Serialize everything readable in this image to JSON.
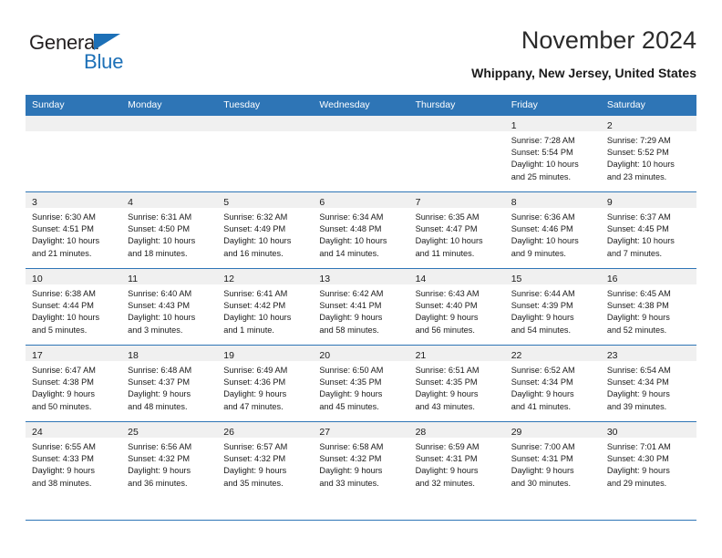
{
  "brand": {
    "name_part1": "General",
    "name_part2": "Blue",
    "triangle_color": "#1d70b7"
  },
  "header": {
    "title": "November 2024",
    "location": "Whippany, New Jersey, United States"
  },
  "theme": {
    "header_blue": "#2e75b6",
    "daynum_band": "#f0f0f0",
    "text": "#1a1a1a"
  },
  "weekday_headers": [
    "Sunday",
    "Monday",
    "Tuesday",
    "Wednesday",
    "Thursday",
    "Friday",
    "Saturday"
  ],
  "weeks": [
    [
      {
        "day": "",
        "sunrise": "",
        "sunset": "",
        "daylight_line1": "",
        "daylight_line2": ""
      },
      {
        "day": "",
        "sunrise": "",
        "sunset": "",
        "daylight_line1": "",
        "daylight_line2": ""
      },
      {
        "day": "",
        "sunrise": "",
        "sunset": "",
        "daylight_line1": "",
        "daylight_line2": ""
      },
      {
        "day": "",
        "sunrise": "",
        "sunset": "",
        "daylight_line1": "",
        "daylight_line2": ""
      },
      {
        "day": "",
        "sunrise": "",
        "sunset": "",
        "daylight_line1": "",
        "daylight_line2": ""
      },
      {
        "day": "1",
        "sunrise": "Sunrise: 7:28 AM",
        "sunset": "Sunset: 5:54 PM",
        "daylight_line1": "Daylight: 10 hours",
        "daylight_line2": "and 25 minutes."
      },
      {
        "day": "2",
        "sunrise": "Sunrise: 7:29 AM",
        "sunset": "Sunset: 5:52 PM",
        "daylight_line1": "Daylight: 10 hours",
        "daylight_line2": "and 23 minutes."
      }
    ],
    [
      {
        "day": "3",
        "sunrise": "Sunrise: 6:30 AM",
        "sunset": "Sunset: 4:51 PM",
        "daylight_line1": "Daylight: 10 hours",
        "daylight_line2": "and 21 minutes."
      },
      {
        "day": "4",
        "sunrise": "Sunrise: 6:31 AM",
        "sunset": "Sunset: 4:50 PM",
        "daylight_line1": "Daylight: 10 hours",
        "daylight_line2": "and 18 minutes."
      },
      {
        "day": "5",
        "sunrise": "Sunrise: 6:32 AM",
        "sunset": "Sunset: 4:49 PM",
        "daylight_line1": "Daylight: 10 hours",
        "daylight_line2": "and 16 minutes."
      },
      {
        "day": "6",
        "sunrise": "Sunrise: 6:34 AM",
        "sunset": "Sunset: 4:48 PM",
        "daylight_line1": "Daylight: 10 hours",
        "daylight_line2": "and 14 minutes."
      },
      {
        "day": "7",
        "sunrise": "Sunrise: 6:35 AM",
        "sunset": "Sunset: 4:47 PM",
        "daylight_line1": "Daylight: 10 hours",
        "daylight_line2": "and 11 minutes."
      },
      {
        "day": "8",
        "sunrise": "Sunrise: 6:36 AM",
        "sunset": "Sunset: 4:46 PM",
        "daylight_line1": "Daylight: 10 hours",
        "daylight_line2": "and 9 minutes."
      },
      {
        "day": "9",
        "sunrise": "Sunrise: 6:37 AM",
        "sunset": "Sunset: 4:45 PM",
        "daylight_line1": "Daylight: 10 hours",
        "daylight_line2": "and 7 minutes."
      }
    ],
    [
      {
        "day": "10",
        "sunrise": "Sunrise: 6:38 AM",
        "sunset": "Sunset: 4:44 PM",
        "daylight_line1": "Daylight: 10 hours",
        "daylight_line2": "and 5 minutes."
      },
      {
        "day": "11",
        "sunrise": "Sunrise: 6:40 AM",
        "sunset": "Sunset: 4:43 PM",
        "daylight_line1": "Daylight: 10 hours",
        "daylight_line2": "and 3 minutes."
      },
      {
        "day": "12",
        "sunrise": "Sunrise: 6:41 AM",
        "sunset": "Sunset: 4:42 PM",
        "daylight_line1": "Daylight: 10 hours",
        "daylight_line2": "and 1 minute."
      },
      {
        "day": "13",
        "sunrise": "Sunrise: 6:42 AM",
        "sunset": "Sunset: 4:41 PM",
        "daylight_line1": "Daylight: 9 hours",
        "daylight_line2": "and 58 minutes."
      },
      {
        "day": "14",
        "sunrise": "Sunrise: 6:43 AM",
        "sunset": "Sunset: 4:40 PM",
        "daylight_line1": "Daylight: 9 hours",
        "daylight_line2": "and 56 minutes."
      },
      {
        "day": "15",
        "sunrise": "Sunrise: 6:44 AM",
        "sunset": "Sunset: 4:39 PM",
        "daylight_line1": "Daylight: 9 hours",
        "daylight_line2": "and 54 minutes."
      },
      {
        "day": "16",
        "sunrise": "Sunrise: 6:45 AM",
        "sunset": "Sunset: 4:38 PM",
        "daylight_line1": "Daylight: 9 hours",
        "daylight_line2": "and 52 minutes."
      }
    ],
    [
      {
        "day": "17",
        "sunrise": "Sunrise: 6:47 AM",
        "sunset": "Sunset: 4:38 PM",
        "daylight_line1": "Daylight: 9 hours",
        "daylight_line2": "and 50 minutes."
      },
      {
        "day": "18",
        "sunrise": "Sunrise: 6:48 AM",
        "sunset": "Sunset: 4:37 PM",
        "daylight_line1": "Daylight: 9 hours",
        "daylight_line2": "and 48 minutes."
      },
      {
        "day": "19",
        "sunrise": "Sunrise: 6:49 AM",
        "sunset": "Sunset: 4:36 PM",
        "daylight_line1": "Daylight: 9 hours",
        "daylight_line2": "and 47 minutes."
      },
      {
        "day": "20",
        "sunrise": "Sunrise: 6:50 AM",
        "sunset": "Sunset: 4:35 PM",
        "daylight_line1": "Daylight: 9 hours",
        "daylight_line2": "and 45 minutes."
      },
      {
        "day": "21",
        "sunrise": "Sunrise: 6:51 AM",
        "sunset": "Sunset: 4:35 PM",
        "daylight_line1": "Daylight: 9 hours",
        "daylight_line2": "and 43 minutes."
      },
      {
        "day": "22",
        "sunrise": "Sunrise: 6:52 AM",
        "sunset": "Sunset: 4:34 PM",
        "daylight_line1": "Daylight: 9 hours",
        "daylight_line2": "and 41 minutes."
      },
      {
        "day": "23",
        "sunrise": "Sunrise: 6:54 AM",
        "sunset": "Sunset: 4:34 PM",
        "daylight_line1": "Daylight: 9 hours",
        "daylight_line2": "and 39 minutes."
      }
    ],
    [
      {
        "day": "24",
        "sunrise": "Sunrise: 6:55 AM",
        "sunset": "Sunset: 4:33 PM",
        "daylight_line1": "Daylight: 9 hours",
        "daylight_line2": "and 38 minutes."
      },
      {
        "day": "25",
        "sunrise": "Sunrise: 6:56 AM",
        "sunset": "Sunset: 4:32 PM",
        "daylight_line1": "Daylight: 9 hours",
        "daylight_line2": "and 36 minutes."
      },
      {
        "day": "26",
        "sunrise": "Sunrise: 6:57 AM",
        "sunset": "Sunset: 4:32 PM",
        "daylight_line1": "Daylight: 9 hours",
        "daylight_line2": "and 35 minutes."
      },
      {
        "day": "27",
        "sunrise": "Sunrise: 6:58 AM",
        "sunset": "Sunset: 4:32 PM",
        "daylight_line1": "Daylight: 9 hours",
        "daylight_line2": "and 33 minutes."
      },
      {
        "day": "28",
        "sunrise": "Sunrise: 6:59 AM",
        "sunset": "Sunset: 4:31 PM",
        "daylight_line1": "Daylight: 9 hours",
        "daylight_line2": "and 32 minutes."
      },
      {
        "day": "29",
        "sunrise": "Sunrise: 7:00 AM",
        "sunset": "Sunset: 4:31 PM",
        "daylight_line1": "Daylight: 9 hours",
        "daylight_line2": "and 30 minutes."
      },
      {
        "day": "30",
        "sunrise": "Sunrise: 7:01 AM",
        "sunset": "Sunset: 4:30 PM",
        "daylight_line1": "Daylight: 9 hours",
        "daylight_line2": "and 29 minutes."
      }
    ]
  ]
}
